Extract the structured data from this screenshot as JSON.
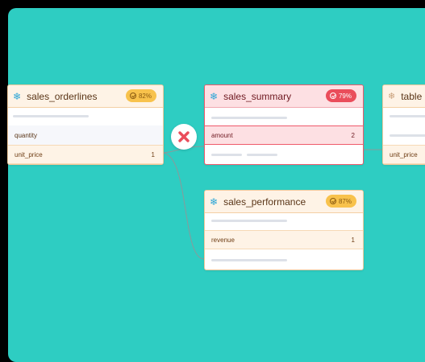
{
  "nodes": {
    "orderlines": {
      "title": "sales_orderlines",
      "badge": "82%",
      "rows": [
        {
          "name": "quantity",
          "count": ""
        },
        {
          "name": "unit_price",
          "count": "1"
        }
      ]
    },
    "summary": {
      "title": "sales_summary",
      "badge": "79%",
      "rows": [
        {
          "name": "amount",
          "count": "2"
        }
      ]
    },
    "performance": {
      "title": "sales_performance",
      "badge": "87%",
      "rows": [
        {
          "name": "revenue",
          "count": "1"
        }
      ]
    },
    "partial": {
      "title": "table",
      "rows": [
        {
          "name": "unit_price",
          "count": ""
        }
      ]
    }
  },
  "icons": {
    "table_icon": "snowflake-icon",
    "badge_icon": "check-circle-icon",
    "connector_icon": "cross-error-icon"
  },
  "colors": {
    "canvas": "#2ecdc2",
    "warning": "#f8c24c",
    "error": "#ea4d5b"
  }
}
